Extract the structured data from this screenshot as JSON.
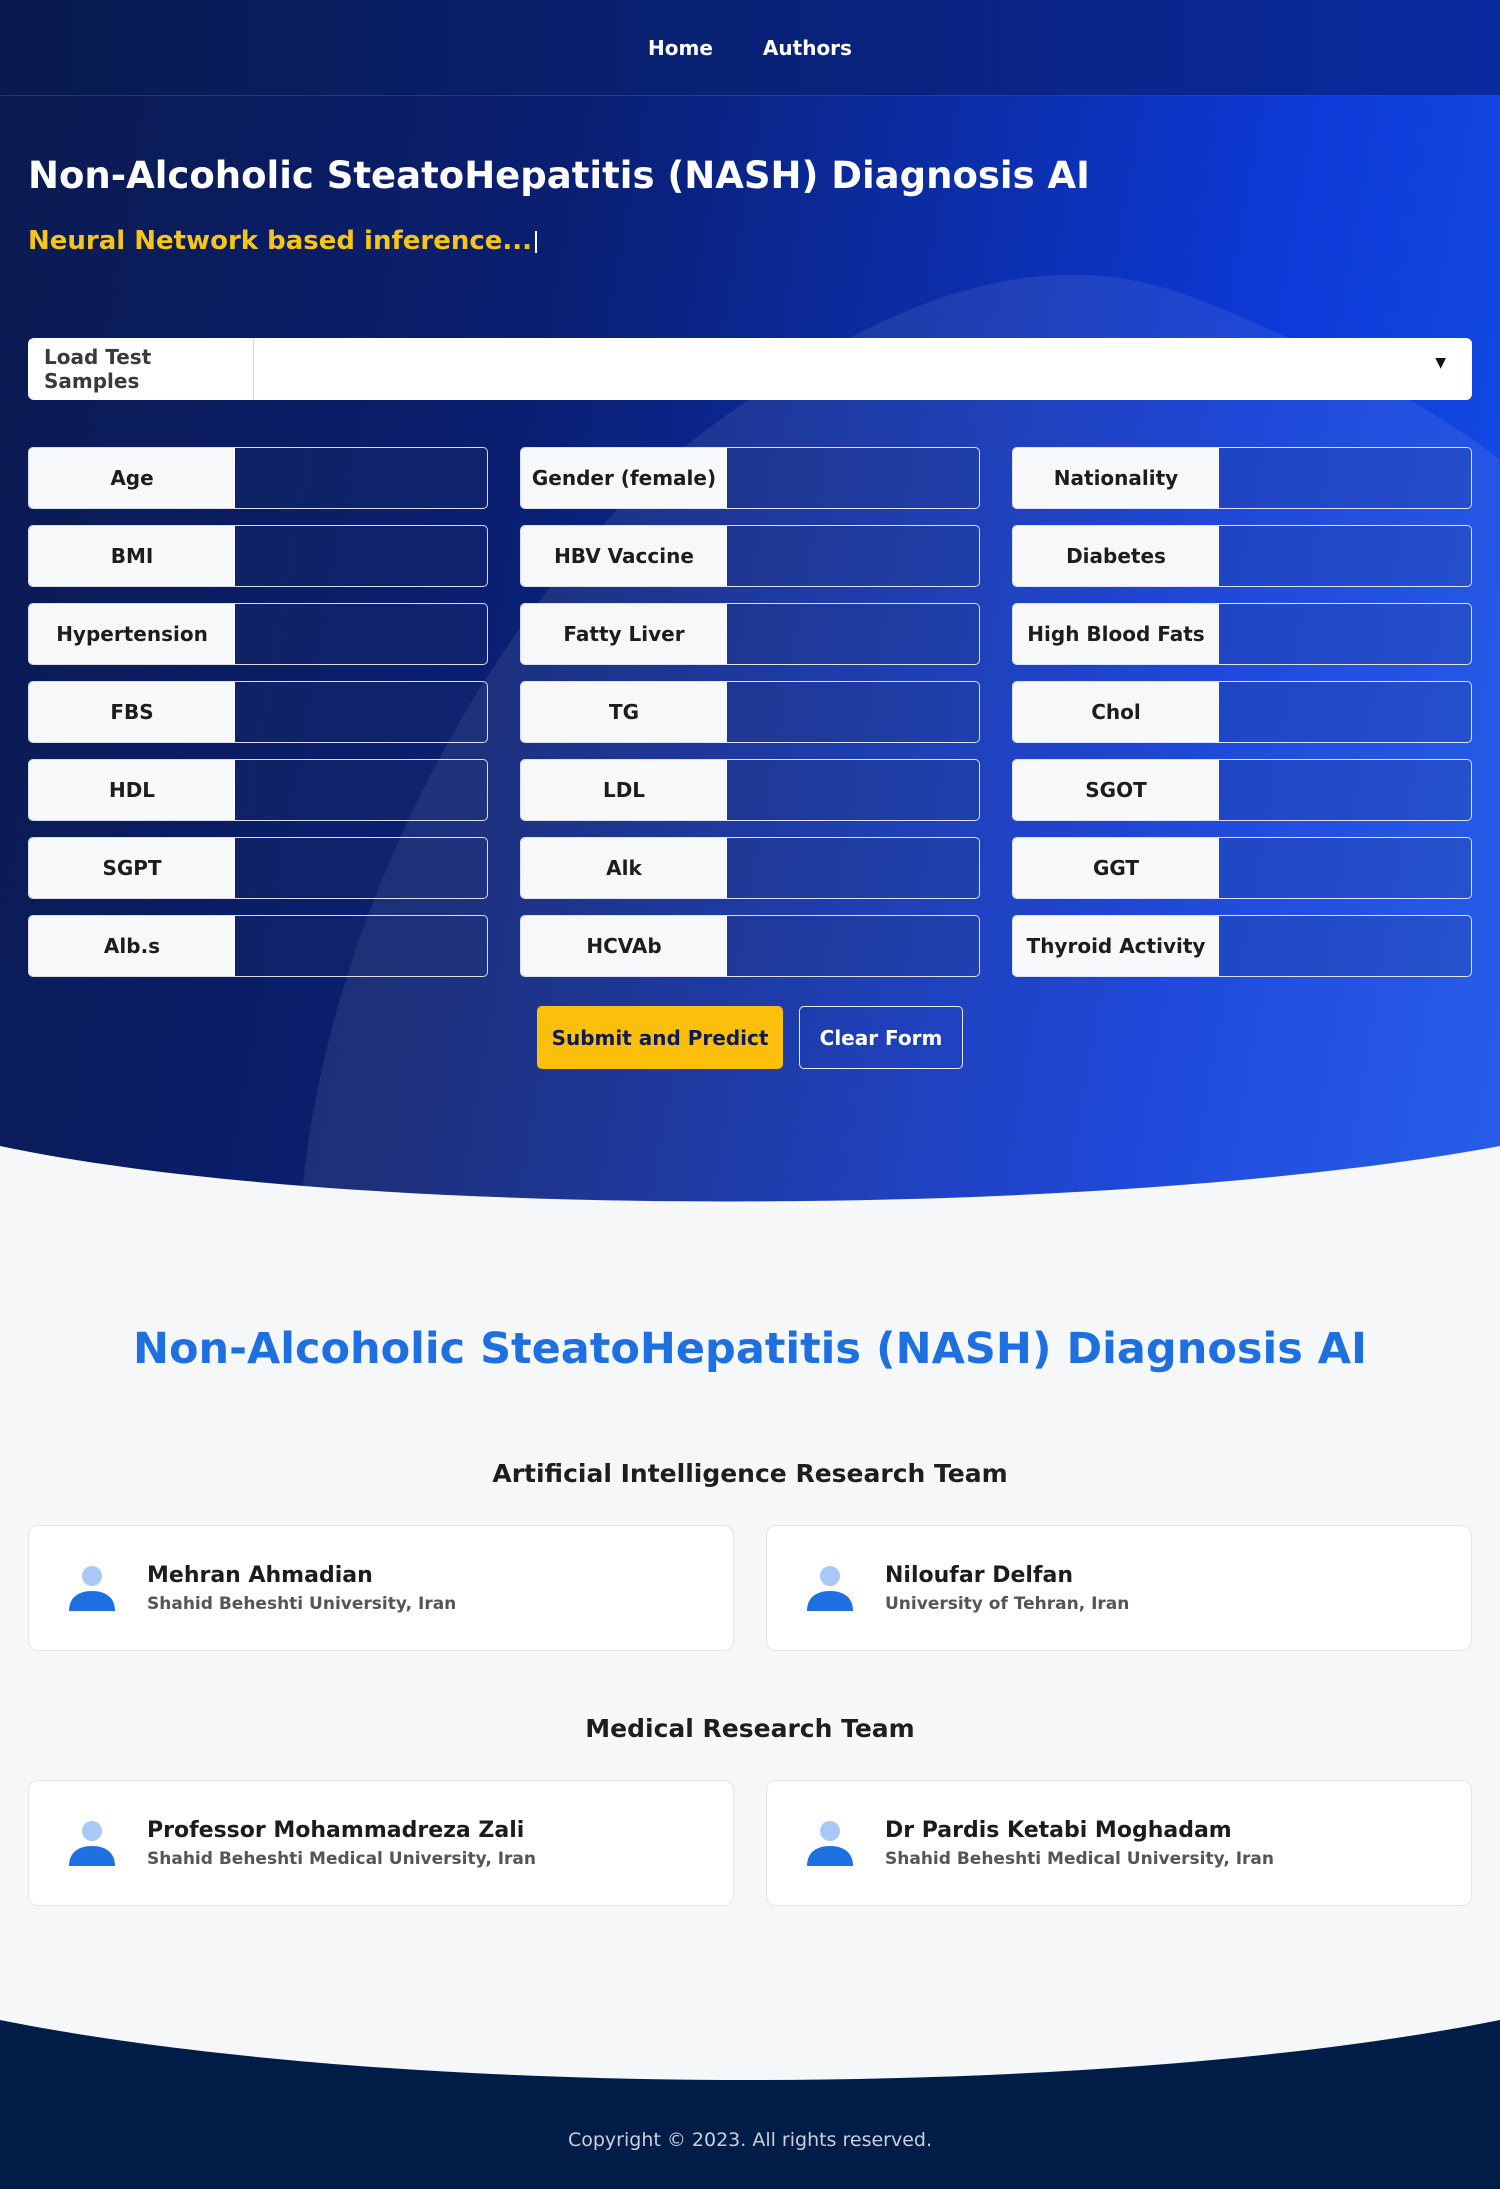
{
  "nav": {
    "home": "Home",
    "authors": "Authors"
  },
  "hero": {
    "title": "Non-Alcoholic SteatoHepatitis (NASH) Diagnosis AI",
    "subtitle": "Neural Network based inference..."
  },
  "samples": {
    "label": "Load Test Samples",
    "selected": ""
  },
  "fields": [
    {
      "label": "Age",
      "value": ""
    },
    {
      "label": "Gender (female)",
      "value": ""
    },
    {
      "label": "Nationality",
      "value": ""
    },
    {
      "label": "BMI",
      "value": ""
    },
    {
      "label": "HBV Vaccine",
      "value": ""
    },
    {
      "label": "Diabetes",
      "value": ""
    },
    {
      "label": "Hypertension",
      "value": ""
    },
    {
      "label": "Fatty Liver",
      "value": ""
    },
    {
      "label": "High Blood Fats",
      "value": ""
    },
    {
      "label": "FBS",
      "value": ""
    },
    {
      "label": "TG",
      "value": ""
    },
    {
      "label": "Chol",
      "value": ""
    },
    {
      "label": "HDL",
      "value": ""
    },
    {
      "label": "LDL",
      "value": ""
    },
    {
      "label": "SGOT",
      "value": ""
    },
    {
      "label": "SGPT",
      "value": ""
    },
    {
      "label": "Alk",
      "value": ""
    },
    {
      "label": "GGT",
      "value": ""
    },
    {
      "label": "Alb.s",
      "value": ""
    },
    {
      "label": "HCVAb",
      "value": ""
    },
    {
      "label": "Thyroid Activity",
      "value": ""
    }
  ],
  "actions": {
    "submit": "Submit and Predict",
    "clear": "Clear Form"
  },
  "authors": {
    "title": "Non-Alcoholic SteatoHepatitis (NASH) Diagnosis AI",
    "ai_team": {
      "heading": "Artificial Intelligence Research Team",
      "members": [
        {
          "name": "Mehran Ahmadian",
          "affiliation": "Shahid Beheshti University, Iran"
        },
        {
          "name": "Niloufar Delfan",
          "affiliation": "University of Tehran, Iran"
        }
      ]
    },
    "medical_team": {
      "heading": "Medical Research Team",
      "members": [
        {
          "name": "Professor Mohammadreza Zali",
          "affiliation": "Shahid Beheshti Medical University, Iran"
        },
        {
          "name": "Dr Pardis Ketabi Moghadam",
          "affiliation": "Shahid Beheshti Medical University, Iran"
        }
      ]
    }
  },
  "footer": {
    "copyright": "Copyright © 2023. All rights reserved."
  },
  "colors": {
    "accent": "#fbbf0c",
    "brand_blue": "#1e6fe0",
    "footer_bg": "#001d47"
  },
  "icons": {
    "avatar": "user-avatar-icon",
    "dropdown": "caret-down-icon"
  }
}
